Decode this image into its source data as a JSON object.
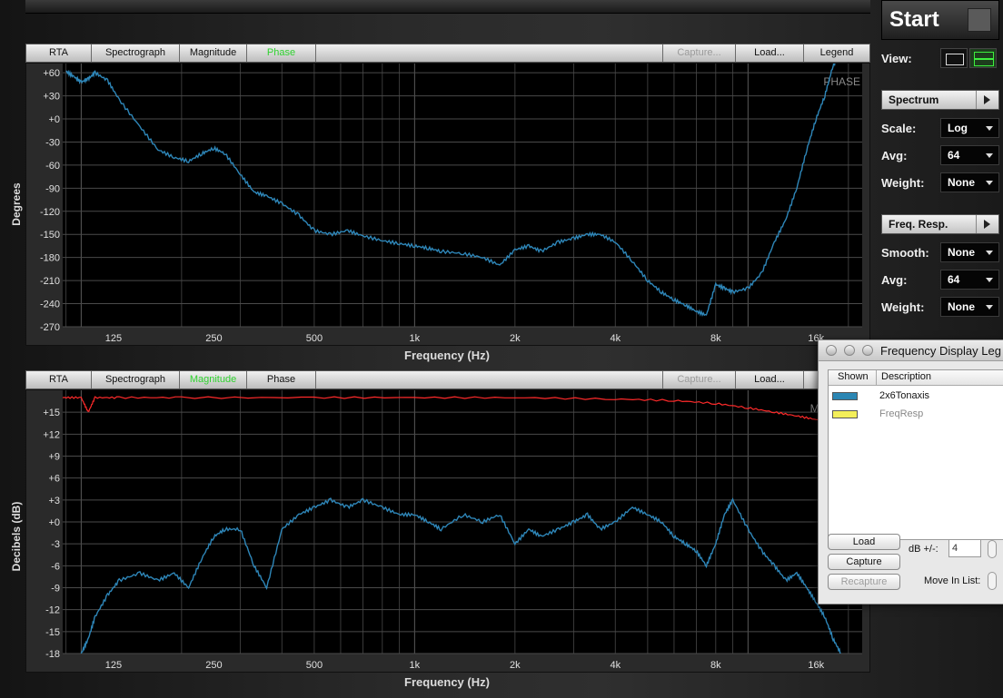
{
  "tabs_top": {
    "rta": "RTA",
    "spectrograph": "Spectrograph",
    "magnitude": "Magnitude",
    "phase": "Phase",
    "capture": "Capture...",
    "load": "Load...",
    "legend": "Legend"
  },
  "tabs_bottom": {
    "rta": "RTA",
    "spectrograph": "Spectrograph",
    "magnitude": "Magnitude",
    "phase": "Phase",
    "capture": "Capture...",
    "load": "Load..."
  },
  "phase_chart": {
    "ylabel": "Degrees",
    "xlabel": "Frequency (Hz)",
    "watermark": "PHASE",
    "yticks": [
      "+60",
      "+30",
      "+0",
      "-30",
      "-60",
      "-90",
      "-120",
      "-150",
      "-180",
      "-210",
      "-240",
      "-270"
    ],
    "xticks": [
      "125",
      "250",
      "500",
      "1k",
      "2k",
      "4k",
      "8k",
      "16k"
    ]
  },
  "mag_chart": {
    "ylabel": "Decibels (dB)",
    "xlabel": "Frequency (Hz)",
    "watermark": "MAGNITU",
    "yticks": [
      "+15",
      "+12",
      "+9",
      "+6",
      "+3",
      "+0",
      "-3",
      "-6",
      "-9",
      "-12",
      "-15",
      "-18"
    ],
    "xticks": [
      "125",
      "250",
      "500",
      "1k",
      "2k",
      "4k",
      "8k",
      "16k"
    ]
  },
  "chart_data": [
    {
      "type": "line",
      "ylabel": "Degrees",
      "xlabel": "Frequency (Hz)",
      "x_scale": "log",
      "xlim": [
        88,
        22000
      ],
      "ylim": [
        -270,
        72
      ],
      "series": [
        {
          "name": "2x6Tonaxis",
          "color": "#2e86b8",
          "x": [
            90,
            95,
            100,
            105,
            110,
            120,
            130,
            150,
            170,
            190,
            210,
            230,
            250,
            270,
            300,
            330,
            360,
            400,
            450,
            500,
            560,
            630,
            700,
            800,
            900,
            1000,
            1100,
            1200,
            1400,
            1600,
            1800,
            2000,
            2200,
            2400,
            2700,
            3000,
            3300,
            3600,
            4000,
            4500,
            5000,
            5500,
            6000,
            6500,
            7000,
            7500,
            8000,
            8500,
            9000,
            10000,
            11000,
            12000,
            13000,
            14000,
            15000,
            16000,
            17000,
            18000,
            19000
          ],
          "y": [
            62,
            55,
            48,
            52,
            60,
            50,
            25,
            -10,
            -40,
            -50,
            -55,
            -45,
            -38,
            -45,
            -72,
            -95,
            -100,
            -110,
            -125,
            -145,
            -150,
            -145,
            -152,
            -158,
            -162,
            -165,
            -168,
            -172,
            -175,
            -180,
            -190,
            -170,
            -165,
            -172,
            -160,
            -155,
            -150,
            -150,
            -160,
            -185,
            -210,
            -225,
            -235,
            -242,
            -250,
            -255,
            -215,
            -220,
            -225,
            -220,
            -200,
            -160,
            -130,
            -90,
            -40,
            0,
            30,
            70,
            85
          ]
        }
      ]
    },
    {
      "type": "line",
      "ylabel": "Decibels (dB)",
      "xlabel": "Frequency (Hz)",
      "x_scale": "log",
      "xlim": [
        88,
        22000
      ],
      "ylim": [
        -18,
        18
      ],
      "series": [
        {
          "name": "2x6Tonaxis",
          "color": "#2e86b8",
          "x": [
            100,
            105,
            110,
            120,
            130,
            150,
            170,
            190,
            210,
            230,
            250,
            270,
            300,
            330,
            360,
            400,
            450,
            500,
            560,
            630,
            700,
            800,
            900,
            1000,
            1100,
            1200,
            1400,
            1600,
            1800,
            2000,
            2200,
            2400,
            2700,
            3000,
            3300,
            3600,
            4000,
            4500,
            5000,
            5500,
            6000,
            6500,
            7000,
            7500,
            8000,
            8500,
            9000,
            10000,
            11000,
            12000,
            13000,
            14000,
            15000,
            16000,
            17000,
            18000,
            19000
          ],
          "y": [
            -18,
            -16,
            -13,
            -10,
            -8,
            -7,
            -8,
            -7,
            -9,
            -5,
            -2,
            -1,
            -1,
            -6,
            -9,
            -1,
            1,
            2,
            3,
            2,
            3,
            2,
            1,
            1,
            0,
            -1,
            1,
            0,
            1,
            -3,
            -1,
            -2,
            -1,
            0,
            1,
            -1,
            0,
            2,
            1,
            0,
            -2,
            -3,
            -4,
            -6,
            -3,
            1,
            3,
            -1,
            -4,
            -6,
            -8,
            -7,
            -9,
            -11,
            -13,
            -16,
            -18
          ]
        },
        {
          "name": "FreqResp",
          "color": "#ff2a2a",
          "x": [
            88,
            100,
            105,
            110,
            130,
            200,
            500,
            1000,
            2000,
            4000,
            6000,
            8000,
            10000,
            12000,
            14000,
            16000,
            18000,
            20000,
            22000
          ],
          "y": [
            17,
            17,
            15,
            17,
            17,
            17,
            17,
            17,
            17,
            16.8,
            16.6,
            16.2,
            15.6,
            15,
            14.5,
            14,
            13.6,
            13.2,
            13
          ]
        }
      ]
    }
  ],
  "sidebar": {
    "start": "Start",
    "view_label": "View:",
    "spectrum": "Spectrum",
    "freq_resp": "Freq. Resp.",
    "scale_label": "Scale:",
    "scale_value": "Log",
    "avg_label": "Avg:",
    "avg_value": "64",
    "weight_label": "Weight:",
    "weight_value": "None",
    "smooth_label": "Smooth:",
    "smooth_value": "None",
    "avg2_label": "Avg:",
    "avg2_value": "64",
    "weight2_label": "Weight:",
    "weight2_value": "None"
  },
  "legend_window": {
    "title": "Frequency Display Leg",
    "col_shown": "Shown",
    "col_description": "Description",
    "rows": [
      {
        "description": "2x6Tonaxis",
        "color": "#2b86b3"
      },
      {
        "description": "FreqResp",
        "color": "#f4ef5a"
      }
    ],
    "load": "Load",
    "capture": "Capture",
    "recapture": "Recapture",
    "db_label": "dB +/-:",
    "db_value": "4",
    "move_label": "Move In List:"
  }
}
